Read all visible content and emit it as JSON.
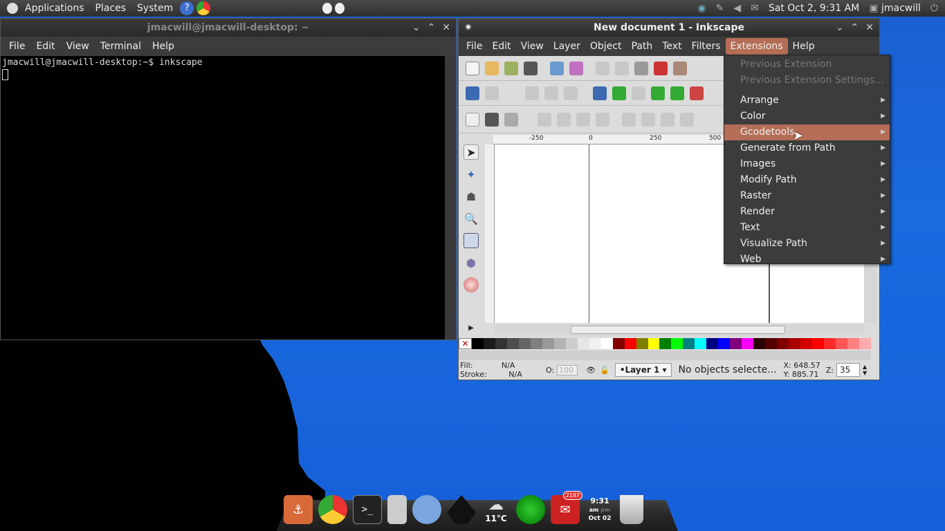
{
  "top_panel": {
    "menus": [
      "Applications",
      "Places",
      "System"
    ],
    "datetime": "Sat Oct  2,  9:31 AM",
    "user": "jmacwill"
  },
  "terminal": {
    "title": "jmacwill@jmacwill-desktop: ~",
    "menus": [
      "File",
      "Edit",
      "View",
      "Terminal",
      "Help"
    ],
    "line": "jmacwill@jmacwill-desktop:~$ inkscape"
  },
  "inkscape": {
    "title": "New document 1 - Inkscape",
    "menus": [
      "File",
      "Edit",
      "View",
      "Layer",
      "Object",
      "Path",
      "Text",
      "Filters",
      "Extensions",
      "Help"
    ],
    "active_menu": "Extensions",
    "ruler_labels": [
      "-250",
      "0",
      "250",
      "500"
    ],
    "status": {
      "fill_label": "Fill:",
      "fill_value": "N/A",
      "stroke_label": "Stroke:",
      "stroke_value": "N/A",
      "opacity_label": "O:",
      "opacity_value": "100",
      "layer": "•Layer 1",
      "message": "No objects selecte...",
      "x_label": "X:",
      "x_value": "648.57",
      "y_label": "Y:",
      "y_value": "885.71",
      "zoom_label": "Z:",
      "zoom_value": "35"
    },
    "palette": [
      "#000000",
      "#1a1a1a",
      "#333333",
      "#4d4d4d",
      "#666666",
      "#808080",
      "#999999",
      "#b3b3b3",
      "#cccccc",
      "#e6e6e6",
      "#f2f2f2",
      "#ffffff",
      "#800000",
      "#ff0000",
      "#808000",
      "#ffff00",
      "#008000",
      "#00ff00",
      "#008080",
      "#00ffff",
      "#000080",
      "#0000ff",
      "#800080",
      "#ff00ff",
      "#2b0000",
      "#550000",
      "#800000",
      "#aa0000",
      "#d40000",
      "#ff0000",
      "#ff2a2a",
      "#ff5555",
      "#ff8080",
      "#ffaaaa"
    ]
  },
  "extensions_menu": {
    "items": [
      {
        "label": "Previous Extension",
        "disabled": true
      },
      {
        "label": "Previous Extension Settings...",
        "disabled": true
      },
      {
        "label": "Arrange",
        "submenu": true
      },
      {
        "label": "Color",
        "submenu": true
      },
      {
        "label": "Gcodetools",
        "submenu": true,
        "highlighted": true
      },
      {
        "label": "Generate from Path",
        "submenu": true
      },
      {
        "label": "Images",
        "submenu": true
      },
      {
        "label": "Modify Path",
        "submenu": true
      },
      {
        "label": "Raster",
        "submenu": true
      },
      {
        "label": "Render",
        "submenu": true
      },
      {
        "label": "Text",
        "submenu": true
      },
      {
        "label": "Visualize Path",
        "submenu": true
      },
      {
        "label": "Web",
        "submenu": true
      }
    ]
  },
  "dock": {
    "weather": "11°C",
    "time": "9:31",
    "am": "am",
    "pm": "pm",
    "date": "Oct 02",
    "mail_count": "2187"
  }
}
